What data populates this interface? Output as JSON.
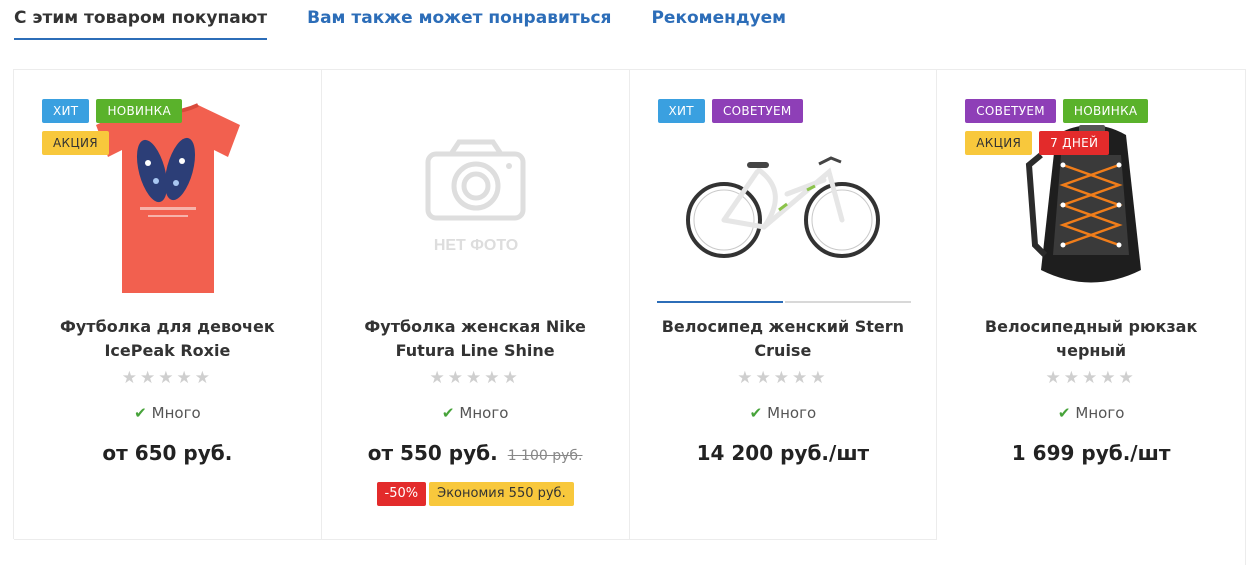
{
  "tabs": [
    {
      "label": "С этим товаром покупают",
      "active": true
    },
    {
      "label": "Вам также может понравиться",
      "active": false
    },
    {
      "label": "Рекомендуем",
      "active": false
    }
  ],
  "products": [
    {
      "badges": [
        {
          "label": "ХИТ",
          "color": "#3aa0e0"
        },
        {
          "label": "НОВИНКА",
          "color": "#5ab22b"
        },
        {
          "label": "АКЦИЯ",
          "color": "#f8c83c"
        }
      ],
      "image": "coral-tshirt-with-flipflop-print",
      "title": "Футболка для девочек IcePeak Roxie",
      "rating": 0,
      "stock": "Много",
      "price": "от 650 руб."
    },
    {
      "badges": [],
      "image_placeholder": "НЕТ ФОТО",
      "title": "Футболка женская Nike Futura Line Shine",
      "rating": 0,
      "stock": "Много",
      "price": "от 550 руб.",
      "old_price": "1 100 руб.",
      "discount_percent": "-50%",
      "economy": "Экономия 550 руб."
    },
    {
      "badges": [
        {
          "label": "ХИТ",
          "color": "#3aa0e0"
        },
        {
          "label": "СОВЕТУЕМ",
          "color": "#8e3fb7"
        }
      ],
      "image": "white-women-bicycle",
      "title": "Велосипед женский Stern Cruise",
      "rating": 0,
      "stock": "Много",
      "price": "14 200 руб./шт"
    },
    {
      "badges": [
        {
          "label": "СОВЕТУЕМ",
          "color": "#8e3fb7"
        },
        {
          "label": "НОВИНКА",
          "color": "#5ab22b"
        },
        {
          "label": "АКЦИЯ",
          "color": "#f8c83c"
        },
        {
          "label": "7 ДНЕЙ",
          "color": "#e32b2b"
        }
      ],
      "image": "black-cycling-backpack",
      "title": "Велосипедный рюкзак черный",
      "rating": 0,
      "stock": "Много",
      "price": "1 699 руб./шт"
    }
  ],
  "stars": "★★★★★",
  "check_icon": "✔"
}
